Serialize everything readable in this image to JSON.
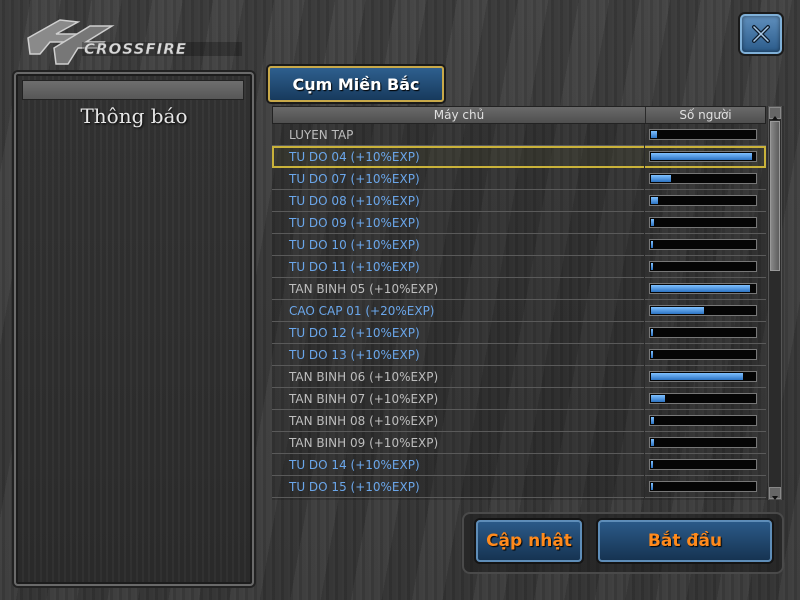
{
  "logo": {
    "text": "CROSSFIRE"
  },
  "close_button": {
    "icon": "close-icon"
  },
  "notice": {
    "title": "Thông báo"
  },
  "region": {
    "label": "Cụm Miền Bắc"
  },
  "server_list": {
    "columns": [
      "Máy chủ",
      "Số người"
    ],
    "rows": [
      {
        "name": "LUYEN TAP",
        "load": 0.06,
        "color": "gray"
      },
      {
        "name": "TU DO 04 (+10%EXP)",
        "load": 0.97,
        "color": "blue",
        "selected": true
      },
      {
        "name": "TU DO 07 (+10%EXP)",
        "load": 0.19,
        "color": "blue"
      },
      {
        "name": "TU DO 08 (+10%EXP)",
        "load": 0.07,
        "color": "blue"
      },
      {
        "name": "TU DO 09 (+10%EXP)",
        "load": 0.03,
        "color": "blue"
      },
      {
        "name": "TU DO 10 (+10%EXP)",
        "load": 0.02,
        "color": "blue"
      },
      {
        "name": "TU DO 11 (+10%EXP)",
        "load": 0.02,
        "color": "blue"
      },
      {
        "name": "TAN BINH 05 (+10%EXP)",
        "load": 0.95,
        "color": "gray"
      },
      {
        "name": "CAO CAP 01 (+20%EXP)",
        "load": 0.51,
        "color": "blue"
      },
      {
        "name": "TU DO 12 (+10%EXP)",
        "load": 0.02,
        "color": "blue"
      },
      {
        "name": "TU DO 13 (+10%EXP)",
        "load": 0.02,
        "color": "blue"
      },
      {
        "name": "TAN BINH 06 (+10%EXP)",
        "load": 0.88,
        "color": "gray"
      },
      {
        "name": "TAN BINH 07 (+10%EXP)",
        "load": 0.13,
        "color": "gray"
      },
      {
        "name": "TAN BINH 08 (+10%EXP)",
        "load": 0.03,
        "color": "gray"
      },
      {
        "name": "TAN BINH 09 (+10%EXP)",
        "load": 0.03,
        "color": "gray"
      },
      {
        "name": "TU DO 14 (+10%EXP)",
        "load": 0.02,
        "color": "blue"
      },
      {
        "name": "TU DO 15 (+10%EXP)",
        "load": 0.02,
        "color": "blue"
      }
    ]
  },
  "buttons": {
    "refresh": "Cập nhật",
    "start": "Bắt đầu"
  },
  "colors": {
    "accent_orange": "#ff8a1c",
    "server_blue": "#6aa6ea",
    "server_gray": "#bdbdbd",
    "selection": "#c9b23a"
  }
}
